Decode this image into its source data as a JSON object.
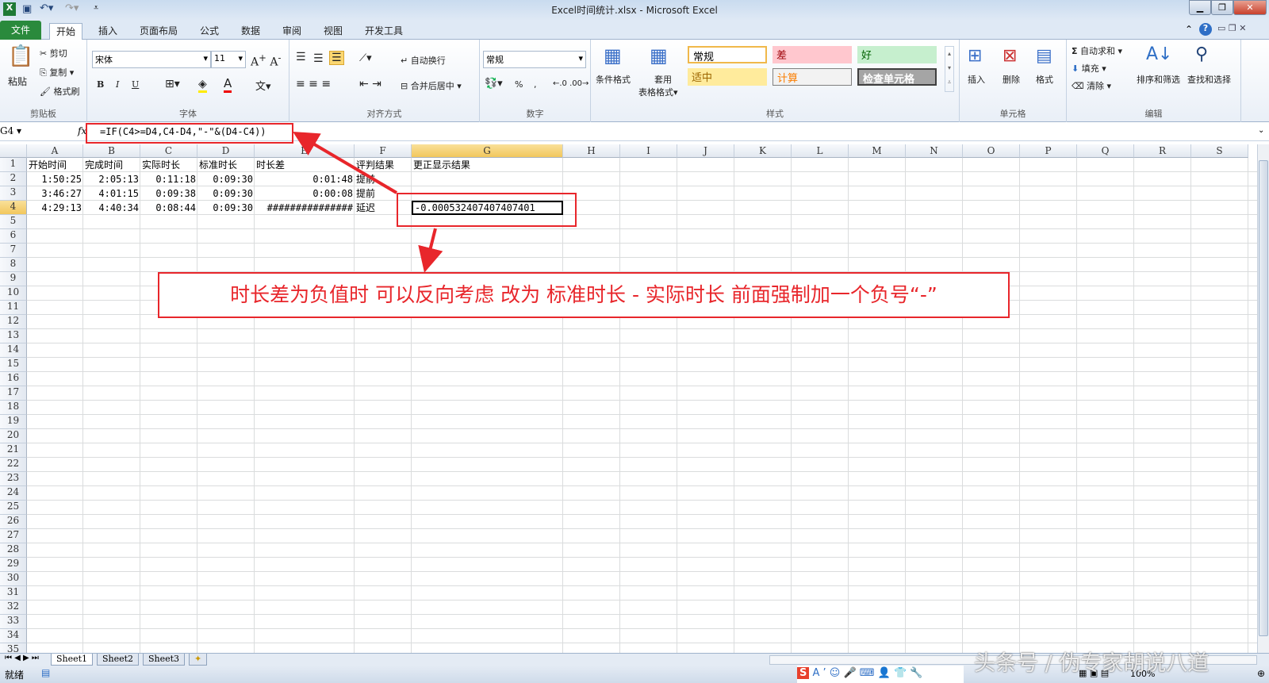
{
  "window": {
    "title": "Excel时间统计.xlsx - Microsoft Excel"
  },
  "tabs": [
    "文件",
    "开始",
    "插入",
    "页面布局",
    "公式",
    "数据",
    "审阅",
    "视图",
    "开发工具"
  ],
  "ribbon": {
    "clipboard": {
      "label": "剪贴板",
      "paste": "粘贴",
      "cut": "剪切",
      "copy": "复制",
      "format_painter": "格式刷"
    },
    "font": {
      "label": "字体",
      "name": "宋体",
      "size": "11",
      "bold": "B",
      "italic": "I",
      "underline": "U"
    },
    "alignment": {
      "label": "对齐方式",
      "wrap": "自动换行",
      "merge": "合并后居中"
    },
    "number": {
      "label": "数字",
      "format": "常规",
      "percent": "%",
      "comma": ","
    },
    "styles": {
      "label": "样式",
      "conditional": "条件格式",
      "table_l1": "套用",
      "table_l2": "表格格式",
      "cells": [
        {
          "text": "常规",
          "bg": "#ffffff",
          "color": "#000000"
        },
        {
          "text": "差",
          "bg": "#ffc7ce",
          "color": "#9c0006"
        },
        {
          "text": "好",
          "bg": "#c6efce",
          "color": "#006100"
        },
        {
          "text": "适中",
          "bg": "#ffeb9c",
          "color": "#9c6500"
        },
        {
          "text": "计算",
          "bg": "#f2f2f2",
          "color": "#fa7d00"
        },
        {
          "text": "检查单元格",
          "bg": "#a5a5a5",
          "color": "#ffffff"
        }
      ]
    },
    "cells": {
      "label": "单元格",
      "insert": "插入",
      "delete": "删除",
      "format": "格式"
    },
    "editing": {
      "label": "编辑",
      "autosum": "自动求和",
      "fill": "填充",
      "clear": "清除",
      "sort": "排序和筛选",
      "find": "查找和选择"
    }
  },
  "formula_bar": {
    "name_box": "G4",
    "fx": "fx",
    "formula": "=IF(C4>=D4,C4-D4,\"-\"&(D4-C4))"
  },
  "columns": [
    "A",
    "B",
    "C",
    "D",
    "E",
    "F",
    "G",
    "H",
    "I",
    "J",
    "K",
    "L",
    "M",
    "N",
    "O",
    "P",
    "Q",
    "R",
    "S"
  ],
  "rows": {
    "1": [
      "开始时间",
      "完成时间",
      "实际时长",
      "标准时长",
      "时长差",
      "评判结果",
      "更正显示结果"
    ],
    "2": [
      "1:50:25",
      "2:05:13",
      "0:11:18",
      "0:09:30",
      "0:01:48",
      "提前",
      ""
    ],
    "3": [
      "3:46:27",
      "4:01:15",
      "0:09:38",
      "0:09:30",
      "0:00:08",
      "提前",
      ""
    ],
    "4": [
      "4:29:13",
      "4:40:34",
      "0:08:44",
      "0:09:30",
      "###############",
      "延迟",
      "-0.000532407407407401"
    ]
  },
  "annotation": {
    "text": "时长差为负值时 可以反向考虑 改为 标准时长 - 实际时长 前面强制加一个负号“-”",
    "color": "#e8262b"
  },
  "sheets": [
    "Sheet1",
    "Sheet2",
    "Sheet3"
  ],
  "status": {
    "ready": "就绪",
    "zoom": "100%"
  },
  "watermark": "头条号 / 伪专家胡说八道"
}
